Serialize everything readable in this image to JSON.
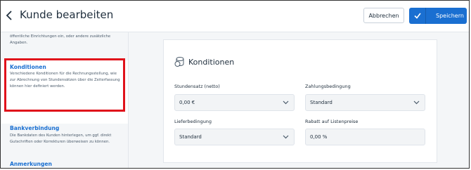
{
  "header": {
    "title": "Kunde bearbeiten",
    "cancel_label": "Abbrechen",
    "save_label": "Speichern"
  },
  "sidebar": {
    "top_description": "öffentliche Einrichtungen ein, oder andere zusätzliche Angaben.",
    "items": [
      {
        "title": "Konditionen",
        "description": "Verschiedene Konditionen für die Rechnungsstellung, wie zur Abrechnung von Stundensätzen über die Zeiterfassung können hier definiert werden."
      },
      {
        "title": "Bankverbindung",
        "description": "Die Bankdaten des Kunden hinterlegen, um ggf. direkt Gutschriften oder Korrekturen überweisen zu können."
      },
      {
        "title": "Anmerkungen"
      }
    ]
  },
  "card": {
    "title": "Konditionen",
    "icon": "coins-icon",
    "fields": [
      {
        "label": "Stundensatz (netto)",
        "value": "0,00 €",
        "type": "select"
      },
      {
        "label": "Zahlungsbedingung",
        "value": "Standard",
        "type": "select"
      },
      {
        "label": "Lieferbedingung",
        "value": "Standard",
        "type": "select"
      },
      {
        "label": "Rabatt auf Listenpreise",
        "value": "0,00 %",
        "type": "input"
      }
    ]
  },
  "colors": {
    "accent": "#1a6fd1",
    "highlight": "#e0121b",
    "background": "#f4f6f8"
  }
}
